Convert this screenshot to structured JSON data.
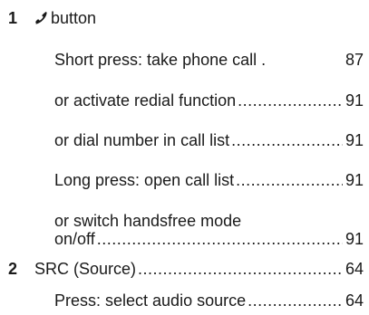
{
  "entries": [
    {
      "number": "1",
      "icon": "phone-handset-icon",
      "headline": "button",
      "items": [
        {
          "text": "Short press: take phone call .",
          "page": "87"
        },
        {
          "text": "or activate redial function",
          "page": "91"
        },
        {
          "text": "or dial number in call list",
          "page": "91"
        },
        {
          "text": "Long press: open call list",
          "page": "91"
        },
        {
          "text_line1": "or switch handsfree mode",
          "text_line2": "on/off",
          "page": "91"
        }
      ]
    },
    {
      "number": "2",
      "headline": "SRC (Source)",
      "headline_page": "64",
      "items": [
        {
          "text": "Press: select audio source",
          "page": "64"
        }
      ]
    }
  ]
}
